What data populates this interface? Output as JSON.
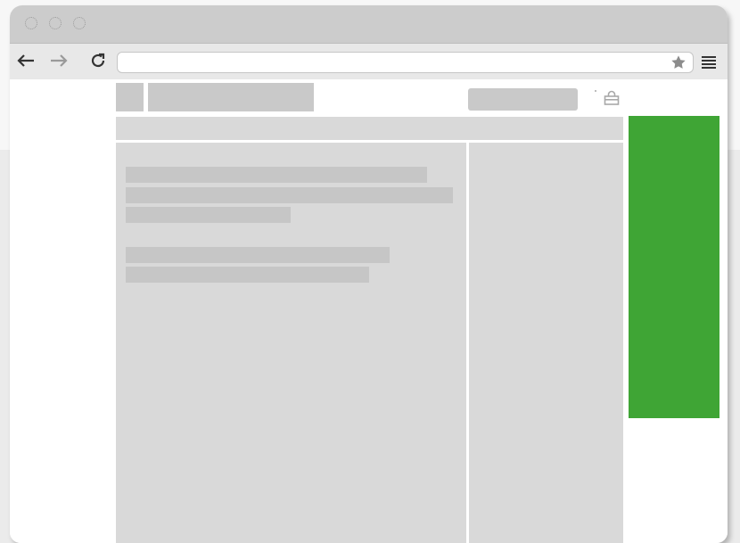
{
  "window": {
    "title": "",
    "traffic_lights": [
      "close-light",
      "minimize-light",
      "zoom-light"
    ]
  },
  "toolbar": {
    "back_icon": "arrow-left-icon",
    "forward_icon": "arrow-right-icon",
    "reload_icon": "reload-icon",
    "address_value": "",
    "bookmark_icon": "star-icon",
    "menu_icon": "hamburger-menu-icon"
  },
  "page": {
    "header": {
      "logo": "logo-placeholder",
      "title_placeholder": "",
      "search_placeholder": "",
      "cart_icon": "shopping-bag-icon"
    },
    "main_text_lines": 5,
    "ad_banner_color": "#3fa535"
  },
  "colors": {
    "placeholder_block": "#d9d9d9",
    "placeholder_line": "#c6c6c6",
    "titlebar": "#cccccc",
    "toolbar": "#e8e8e8",
    "accent_green": "#3fa535"
  }
}
